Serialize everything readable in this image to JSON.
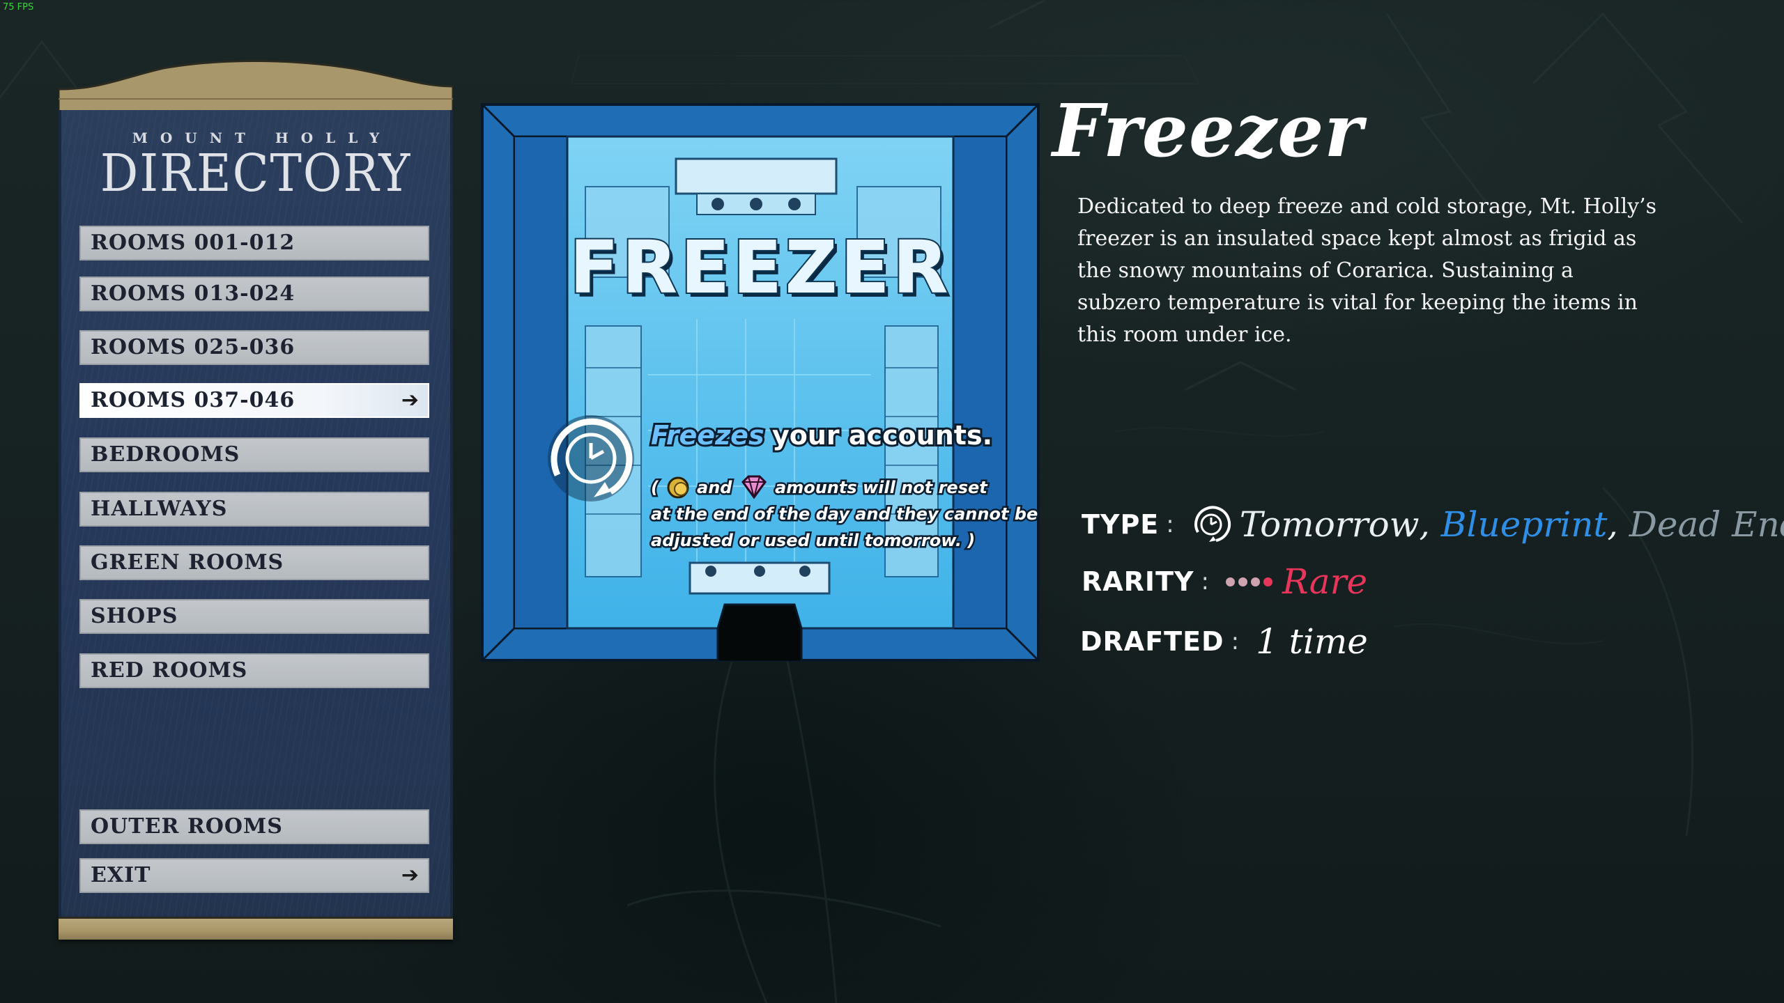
{
  "hud": {
    "fps": "75 FPS"
  },
  "directory": {
    "subtitle": "MOUNT HOLLY",
    "title": "DIRECTORY",
    "items": [
      {
        "label": "ROOMS 001-012"
      },
      {
        "label": "ROOMS 013-024"
      },
      {
        "label": "ROOMS 025-036"
      },
      {
        "label": "ROOMS 037-046",
        "active": true
      },
      {
        "label": "BEDROOMS"
      },
      {
        "label": "HALLWAYS"
      },
      {
        "label": "GREEN ROOMS"
      },
      {
        "label": "SHOPS"
      },
      {
        "label": "RED ROOMS"
      },
      {
        "label": "OUTER ROOMS"
      },
      {
        "label": "EXIT"
      }
    ],
    "arrow_icon": "arrow-right-icon"
  },
  "card": {
    "title": "FREEZER",
    "effect_highlight": "Freezes",
    "effect_rest": "your accounts.",
    "detail_open": "(",
    "detail_and": "and",
    "detail_line1_end": "amounts will not reset",
    "detail_line2": "at the end of the day and they cannot be",
    "detail_line3": "adjusted or used until tomorrow. )",
    "icons": [
      "clock-reset-icon",
      "coin-icon",
      "gem-icon"
    ],
    "colors": {
      "frame": "#1f6db5",
      "floor": "#5fc3ee"
    }
  },
  "info": {
    "name": "Freezer",
    "description": "Dedicated to deep freeze and cold storage, Mt. Holly’s freezer is an insulated space kept almost as frigid as the snowy mountains of Corarica. Sustaining a subzero temperature is vital for keeping the items in this room under ice.",
    "type_label": "TYPE",
    "colon": ":",
    "type_values": [
      "Tomorrow",
      "Blueprint",
      "Dead End"
    ],
    "type_separator": ",",
    "type_icon": "clock-icon",
    "rarity_label": "RARITY",
    "rarity_value": "Rare",
    "rarity_level": 3,
    "rarity_max": 4,
    "drafted_label": "DRAFTED",
    "drafted_value": "1 time",
    "colors": {
      "blueprint": "#2f8fe6",
      "rare": "#e8355a",
      "dead_end": "#8a9aa3"
    }
  }
}
